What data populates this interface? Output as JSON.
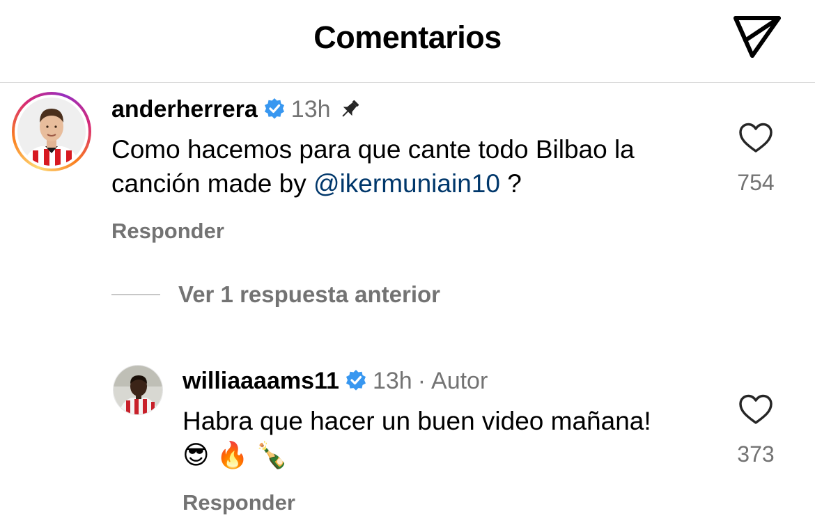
{
  "header": {
    "title": "Comentarios",
    "share_icon": "paper-plane-icon"
  },
  "colors": {
    "username": "#000000",
    "meta": "#737373",
    "mention": "#00376b",
    "verified": "#3897f0",
    "divider": "#dbdbdb"
  },
  "comments": [
    {
      "username": "anderherrera",
      "verified": true,
      "time": "13h",
      "pinned": true,
      "text_before": "Como hacemos para que cante todo Bilbao la canción made by ",
      "mention": "@ikermuniain10",
      "text_after": " ?",
      "likes": "754",
      "reply_label": "Responder",
      "has_story_ring": true
    }
  ],
  "view_replies_label": "Ver 1 respuesta anterior",
  "replies": [
    {
      "username": "williaaaams11",
      "verified": true,
      "time": "13h",
      "separator": "·",
      "author_badge": "Autor",
      "text": "Habra que hacer un buen video mañana! 😎 🔥 🍾",
      "likes": "373",
      "reply_label": "Responder"
    }
  ]
}
